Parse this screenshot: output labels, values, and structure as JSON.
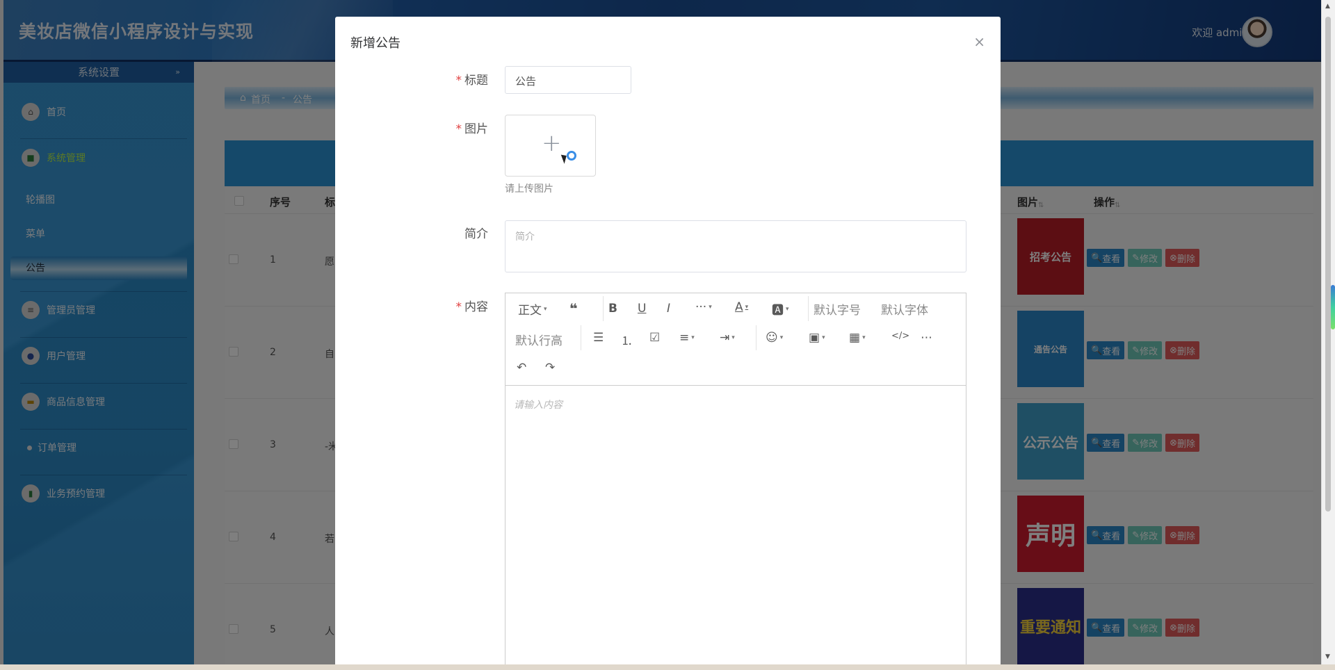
{
  "app": {
    "title": "美妆店微信小程序设计与实现",
    "welcome": "欢迎 admin"
  },
  "sidebar": {
    "section": "系统设置",
    "items": [
      {
        "label": "首页",
        "icon": "home-icon"
      },
      {
        "label": "系统管理",
        "icon": "shirt-icon",
        "active": true
      },
      {
        "label": "管理员管理",
        "icon": "list-icon"
      },
      {
        "label": "用户管理",
        "icon": "user-icon"
      },
      {
        "label": "商品信息管理",
        "icon": "box-icon"
      },
      {
        "label": "订单管理",
        "icon": "dot-icon"
      },
      {
        "label": "业务预约管理",
        "icon": "book-icon"
      }
    ],
    "subitems": [
      "轮播图",
      "菜单",
      "公告"
    ],
    "active_sub": "公告"
  },
  "breadcrumb": {
    "home": "首页",
    "sep": "-",
    "current": "公告"
  },
  "table": {
    "headers": {
      "index": "序号",
      "title": "标",
      "image": "图片",
      "actions": "操作"
    },
    "rows": [
      {
        "index": "1",
        "title": "愿",
        "thumb": "招考公告",
        "thumb_bg": "#b81d26"
      },
      {
        "index": "2",
        "title": "自",
        "thumb": "通告公告",
        "thumb_bg": "#2a86c8"
      },
      {
        "index": "3",
        "title": "-米",
        "thumb": "公示公告",
        "thumb_bg": "#3f9fc9"
      },
      {
        "index": "4",
        "title": "若",
        "thumb": "声明",
        "thumb_bg": "#cf1b2e"
      },
      {
        "index": "5",
        "title": "人",
        "thumb": "重要通知",
        "thumb_bg": "#2a2f8a"
      }
    ],
    "actions": {
      "view": "查看",
      "edit": "修改",
      "delete": "删除"
    }
  },
  "modal": {
    "title": "新增公告",
    "close": "×",
    "fields": {
      "title": {
        "label": "标题",
        "value": "公告"
      },
      "image": {
        "label": "图片",
        "hint": "请上传图片"
      },
      "summary": {
        "label": "简介",
        "placeholder": "简介"
      },
      "content": {
        "label": "内容",
        "placeholder": "请输入内容"
      }
    },
    "editor_toolbar": {
      "heading": "正文",
      "font_size": "默认字号",
      "font_family": "默认字体",
      "line_height": "默认行高",
      "buttons": [
        "quote",
        "bold",
        "underline",
        "italic",
        "more",
        "font-color",
        "bg-color",
        "bullet-list",
        "numbered-list",
        "todo",
        "align",
        "indent",
        "emotion",
        "image",
        "table",
        "code",
        "divider",
        "undo",
        "redo"
      ]
    }
  },
  "colors": {
    "accent": "#2a93d5",
    "active_nav": "#b8f24a",
    "danger": "#e15a5a",
    "edit": "#6ec9b8"
  }
}
